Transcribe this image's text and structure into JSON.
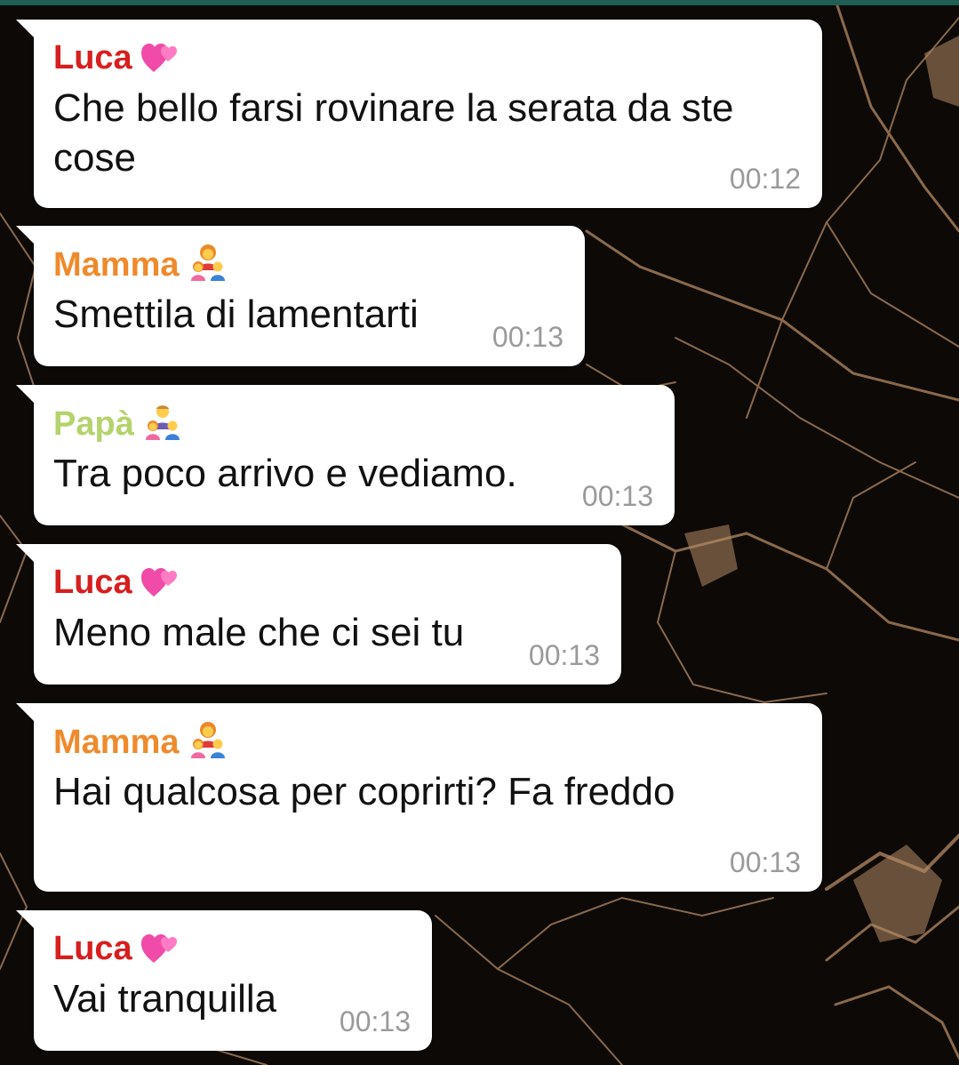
{
  "colors": {
    "luca": "#d81e1e",
    "mamma": "#ef8a2c",
    "papa": "#b4d36c",
    "timestamp": "#9a9a9a",
    "bubble": "#ffffff",
    "header_bar": "#1f5e52"
  },
  "messages": [
    {
      "sender": "Luca",
      "emoji": "two-hearts-icon",
      "text": "Che bello farsi rovinare la serata da ste cose",
      "time": "00:12"
    },
    {
      "sender": "Mamma",
      "emoji": "family-woman-girl-boy-icon",
      "text": "Smettila di lamentarti",
      "time": "00:13"
    },
    {
      "sender": "Papà",
      "emoji": "family-man-girl-boy-icon",
      "text": "Tra poco arrivo e vediamo.",
      "time": "00:13"
    },
    {
      "sender": "Luca",
      "emoji": "two-hearts-icon",
      "text": "Meno male che ci sei tu",
      "time": "00:13"
    },
    {
      "sender": "Mamma",
      "emoji": "family-woman-girl-boy-icon",
      "text": "Hai qualcosa per coprirti? Fa freddo",
      "time": "00:13"
    },
    {
      "sender": "Luca",
      "emoji": "two-hearts-icon",
      "text": "Vai tranquilla",
      "time": "00:13"
    }
  ]
}
